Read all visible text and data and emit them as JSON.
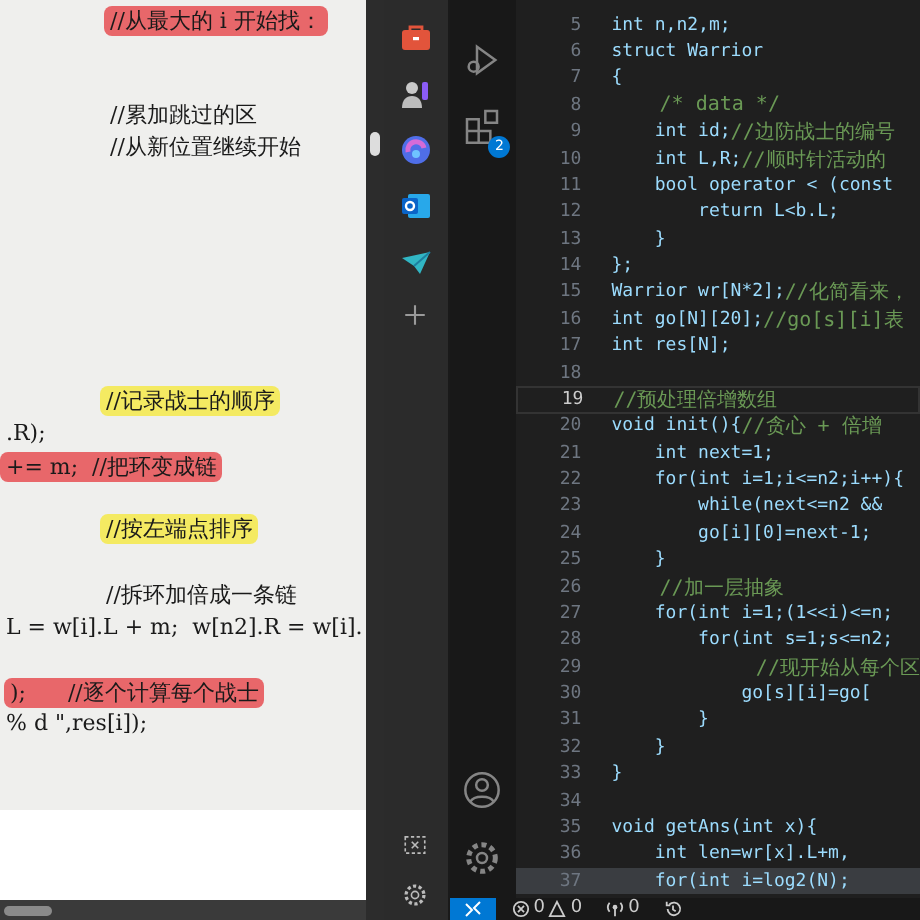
{
  "document": {
    "lines": [
      {
        "text": "//从最大的 i 开始找：",
        "color": "#e8676a"
      },
      {
        "text": "//累加跳过的区"
      },
      {
        "text": "//从新位置继续开始"
      },
      {
        "text": "//记录战士的顺序",
        "color": "#f4ea62"
      },
      {
        "text": ".R);"
      },
      {
        "text": "+= m;  //把环变成链",
        "color": "#e8676a"
      },
      {
        "text": "//按左端点排序",
        "color": "#f4ea62"
      },
      {
        "text": "//拆环加倍成一条链"
      },
      {
        "text": "L = w[i].L + m;  w[n2].R = w[i]."
      },
      {
        "text": ");      //逐个计算每个战士",
        "color": "#e8676a"
      },
      {
        "text": "% d \",res[i]);"
      }
    ]
  },
  "activity_bar": {
    "extensions_badge": "2"
  },
  "editor": {
    "lines": [
      {
        "number": "5",
        "code": "int n,n2,m;",
        "current": false,
        "selected": false
      },
      {
        "number": "6",
        "code": "struct Warrior",
        "current": false,
        "selected": false
      },
      {
        "number": "7",
        "code": "{",
        "current": false,
        "selected": false
      },
      {
        "number": "8",
        "comment": "    /* data */",
        "current": false,
        "selected": false
      },
      {
        "number": "9",
        "code": "    int id;",
        "comment": "//边防战士的编号",
        "current": false,
        "selected": false
      },
      {
        "number": "10",
        "code": "    int L,R;",
        "comment": "//顺时针活动的",
        "current": false,
        "selected": false
      },
      {
        "number": "11",
        "code": "    bool operator < (const",
        "current": false,
        "selected": false
      },
      {
        "number": "12",
        "code": "        return L<b.L;",
        "current": false,
        "selected": false
      },
      {
        "number": "13",
        "code": "    }",
        "current": false,
        "selected": false
      },
      {
        "number": "14",
        "code": "};",
        "current": false,
        "selected": false
      },
      {
        "number": "15",
        "code": "Warrior wr[N*2];",
        "comment": "//化简看来，",
        "current": false,
        "selected": false
      },
      {
        "number": "16",
        "code": "int go[N][20];",
        "comment": "//go[s][i]表",
        "current": false,
        "selected": false
      },
      {
        "number": "17",
        "code": "int res[N];",
        "current": false,
        "selected": false
      },
      {
        "number": "18",
        "current": false,
        "selected": false
      },
      {
        "number": "19",
        "comment": "//预处理倍增数组",
        "current": true,
        "selected": false
      },
      {
        "number": "20",
        "code": "void init(){",
        "comment": "//贪心 + 倍增",
        "current": false,
        "selected": false
      },
      {
        "number": "21",
        "code": "    int next=1;",
        "current": false,
        "selected": false
      },
      {
        "number": "22",
        "code": "    for(int i=1;i<=n2;i++){",
        "current": false,
        "selected": false
      },
      {
        "number": "23",
        "code": "        while(next<=n2 &&",
        "current": false,
        "selected": false
      },
      {
        "number": "24",
        "code": "        go[i][0]=next-1;",
        "current": false,
        "selected": false
      },
      {
        "number": "25",
        "code": "    }",
        "current": false,
        "selected": false
      },
      {
        "number": "26",
        "comment": "    //加一层抽象",
        "current": false,
        "selected": false
      },
      {
        "number": "27",
        "code": "    for(int i=1;(1<<i)<=n;",
        "current": false,
        "selected": false
      },
      {
        "number": "28",
        "code": "        for(int s=1;s<=n2;",
        "current": false,
        "selected": false
      },
      {
        "number": "29",
        "comment": "            //现开始从每个区",
        "current": false,
        "selected": false
      },
      {
        "number": "30",
        "code": "            go[s][i]=go[",
        "current": false,
        "selected": false
      },
      {
        "number": "31",
        "code": "        }",
        "current": false,
        "selected": false
      },
      {
        "number": "32",
        "code": "    }",
        "current": false,
        "selected": false
      },
      {
        "number": "33",
        "code": "}",
        "current": false,
        "selected": false
      },
      {
        "number": "34",
        "current": false,
        "selected": false
      },
      {
        "number": "35",
        "code": "void getAns(int x){",
        "current": false,
        "selected": false
      },
      {
        "number": "36",
        "code": "    int len=wr[x].L+m,",
        "current": false,
        "selected": false
      },
      {
        "number": "37",
        "code": "    for(int i=log2(N);",
        "current": false,
        "selected": true
      }
    ]
  },
  "status_bar": {
    "errors": "0",
    "warnings": "0",
    "ports": "0"
  }
}
